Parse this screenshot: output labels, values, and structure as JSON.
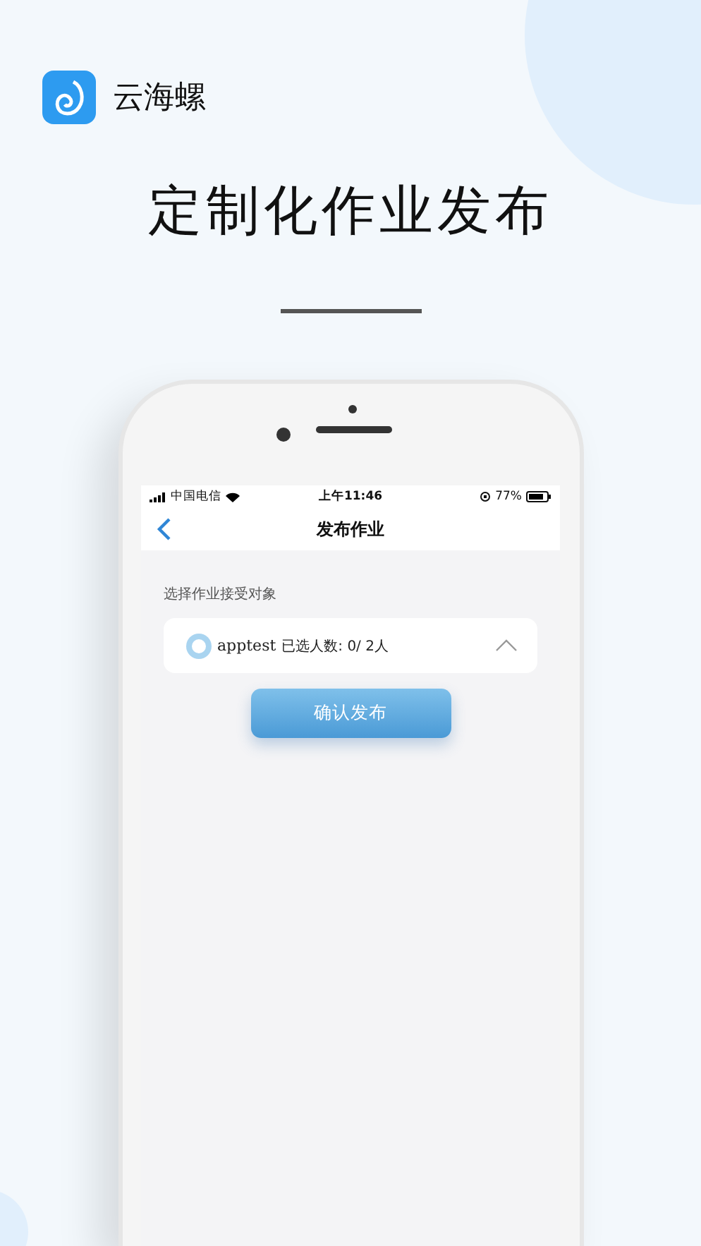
{
  "brand": {
    "name": "云海螺"
  },
  "headline": "定制化作业发布",
  "phone": {
    "status_bar": {
      "carrier": "中国电信",
      "time": "上午11:46",
      "battery": "77%"
    },
    "nav": {
      "title": "发布作业"
    },
    "section_label": "选择作业接受对象",
    "groups": [
      {
        "name": "apptest",
        "count": "已选人数: 0/ 2人",
        "expanded": true
      }
    ],
    "confirm_button": "确认发布"
  }
}
